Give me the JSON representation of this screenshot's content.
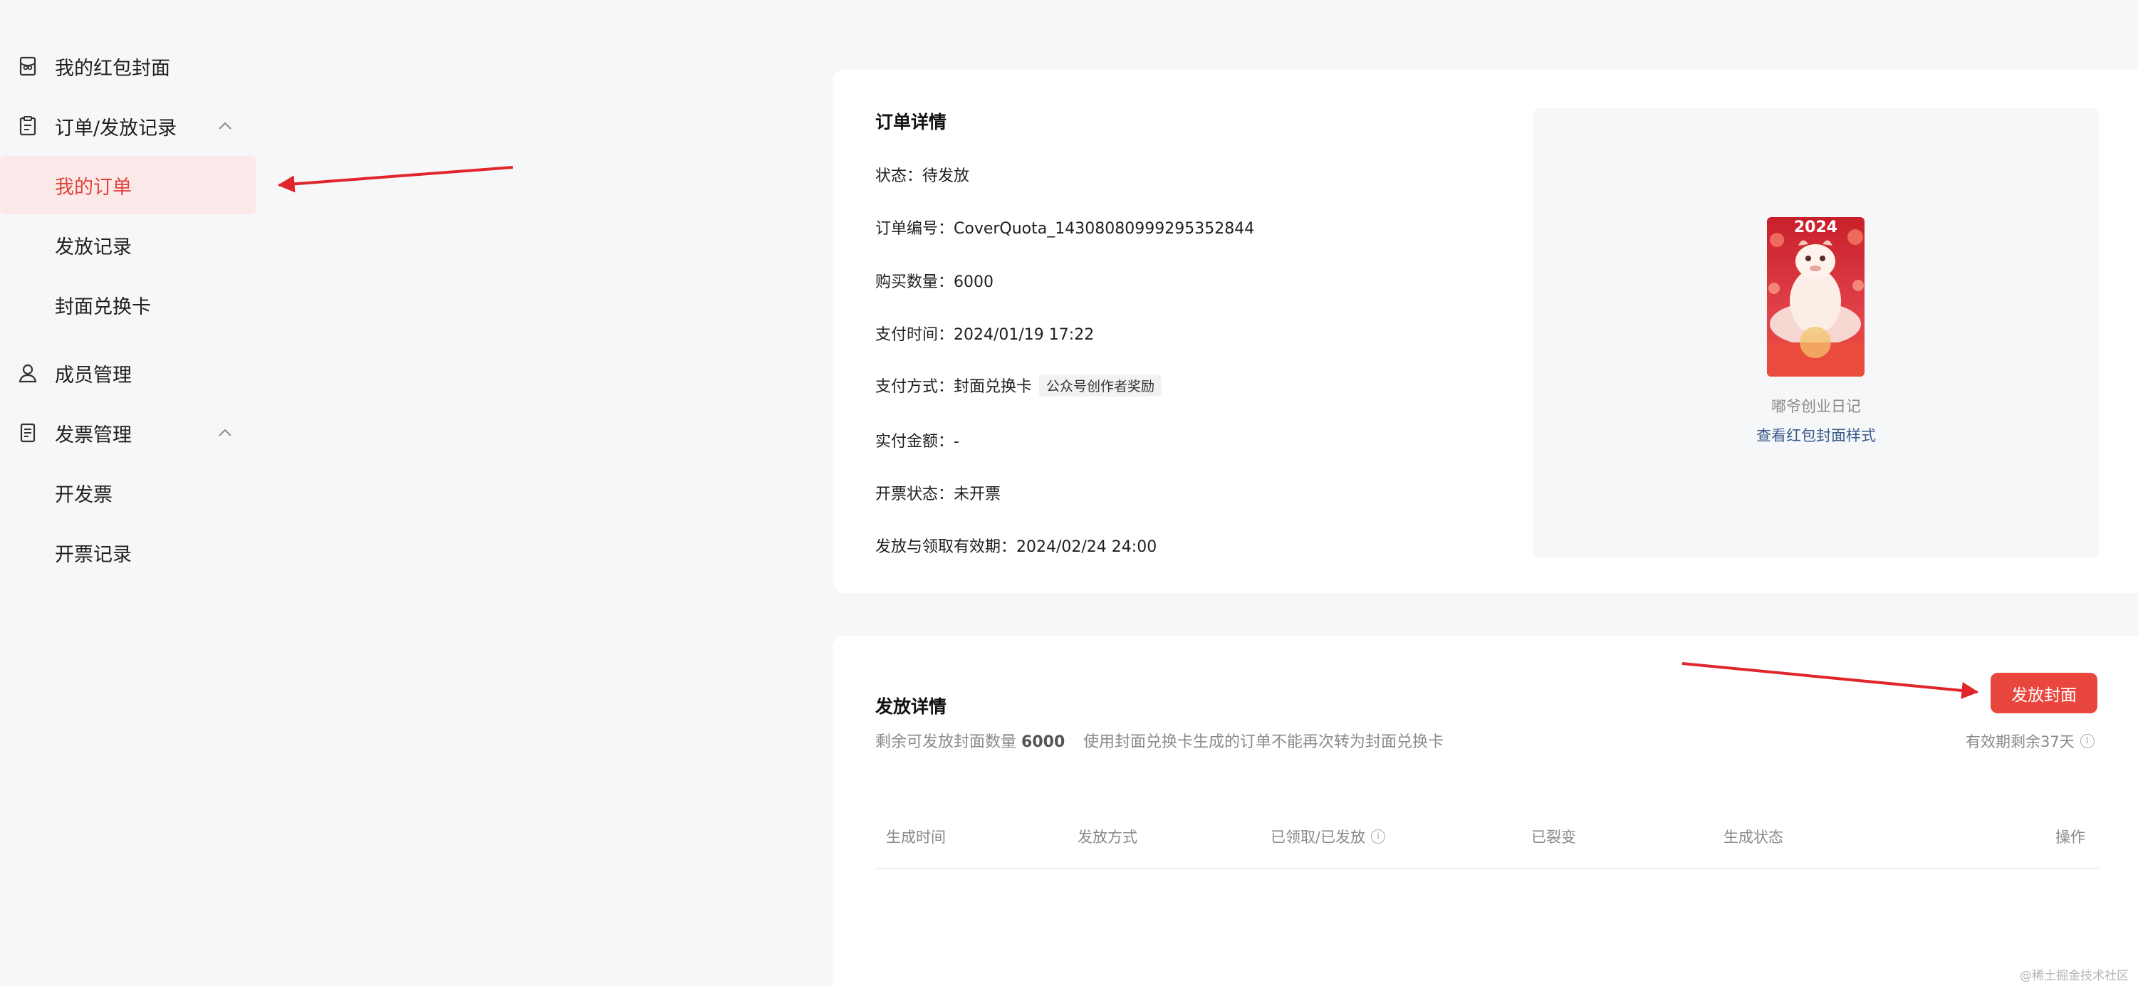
{
  "sidebar": {
    "items": [
      {
        "label": "我的红包封面",
        "icon": "cover-envelope-icon"
      },
      {
        "label": "订单/发放记录",
        "icon": "clipboard-icon"
      },
      {
        "label": "我的订单"
      },
      {
        "label": "发放记录"
      },
      {
        "label": "封面兑换卡"
      },
      {
        "label": "成员管理",
        "icon": "member-icon"
      },
      {
        "label": "发票管理",
        "icon": "invoice-icon"
      },
      {
        "label": "开发票"
      },
      {
        "label": "开票记录"
      }
    ]
  },
  "order": {
    "title": "订单详情",
    "status": "状态：待发放",
    "order_no": "订单编号：CoverQuota_14308080999295352844",
    "quantity": "购买数量：6000",
    "pay_time": "支付时间：2024/01/19 17:22",
    "pay_method": "支付方式：封面兑换卡",
    "pay_method_tag": "公众号创作者奖励",
    "amount": "实付金额：-",
    "invoice_status": "开票状态：未开票",
    "validity": "发放与领取有效期：2024/02/24 24:00"
  },
  "cover": {
    "year": "2024",
    "name": "嘟爷创业日记",
    "view_link": "查看红包封面样式"
  },
  "distribution": {
    "title": "发放详情",
    "remaining_label": "剩余可发放封面数量",
    "remaining_count": "6000",
    "note": "使用封面兑换卡生成的订单不能再次转为封面兑换卡",
    "issue_button": "发放封面",
    "validity_left": "有效期剩余37天",
    "table_headers": [
      "生成时间",
      "发放方式",
      "已领取/已发放",
      "已裂变",
      "生成状态",
      "操作"
    ]
  },
  "colors": {
    "accent": "#e9473e",
    "active_bg": "#fbe9e9",
    "link": "#3a5a8c"
  },
  "watermark": "@稀土掘金技术社区"
}
